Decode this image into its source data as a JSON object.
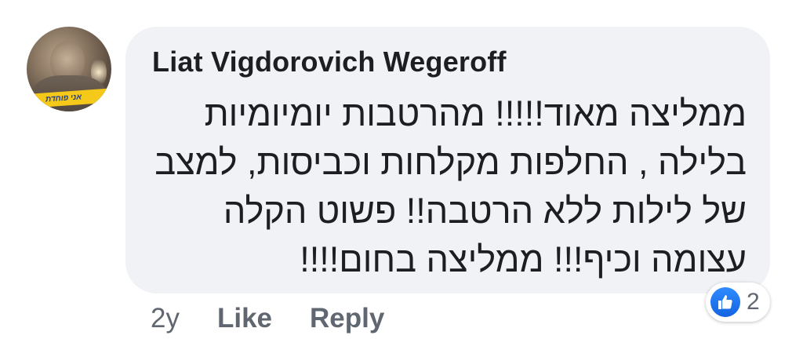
{
  "comment": {
    "author": "Liat Vigdorovich Wegeroff",
    "avatar_banner_text": "אני פוחדת",
    "text_lines": [
      "ממליצה מאוד!!!!! מהרטבות יומיומיות",
      "בלילה , החלפות מקלחות וכביסות, למצב",
      "של לילות ללא הרטבה!! פשוט הקלה",
      "עצומה וכיף!!! ממליצה בחום!!!!"
    ]
  },
  "actions": {
    "age": "2y",
    "like_label": "Like",
    "reply_label": "Reply"
  },
  "reactions": {
    "icon": "thumbs-up-icon",
    "count": "2",
    "color": "#1877f2"
  },
  "colors": {
    "bubble": "#f0f2f5",
    "text": "#1c1e21",
    "meta": "#606770"
  }
}
